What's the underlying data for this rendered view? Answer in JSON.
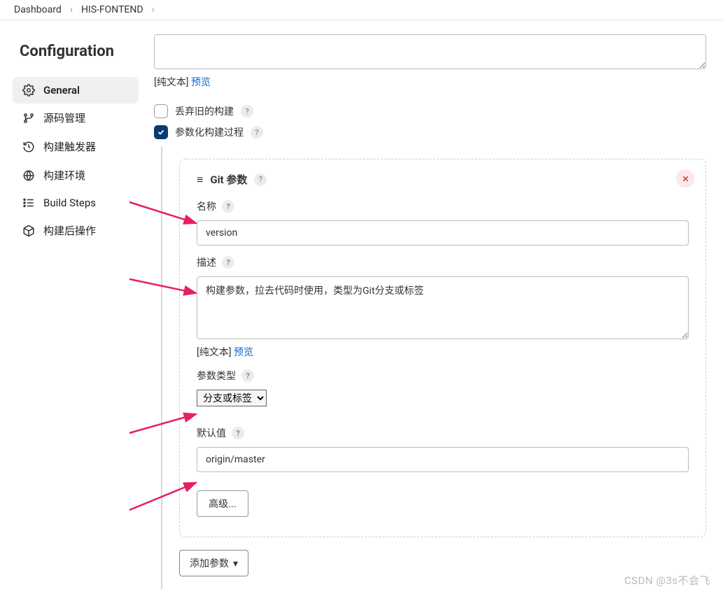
{
  "breadcrumb": {
    "item1": "Dashboard",
    "item2": "HIS-FONTEND"
  },
  "title": "Configuration",
  "sidebar": {
    "items": [
      {
        "label": "General"
      },
      {
        "label": "源码管理"
      },
      {
        "label": "构建触发器"
      },
      {
        "label": "构建环境"
      },
      {
        "label": "Build Steps"
      },
      {
        "label": "构建后操作"
      }
    ]
  },
  "main": {
    "plain_text_bracket": "[纯文本] ",
    "preview_link": "预览",
    "discard_old": {
      "label": "丢弃旧的构建",
      "checked": false
    },
    "parameterized": {
      "label": "参数化构建过程",
      "checked": true
    },
    "git_param": {
      "header": "Git 参数",
      "name_label": "名称",
      "name_value": "version",
      "desc_label": "描述",
      "desc_value": "构建参数，拉去代码时使用，类型为Git分支或标签",
      "param_type_label": "参数类型",
      "param_type_value": "分支或标签",
      "default_label": "默认值",
      "default_value": "origin/master",
      "advanced_label": "高级..."
    },
    "add_param_label": "添加参数"
  },
  "watermark": "CSDN @3s不会飞"
}
